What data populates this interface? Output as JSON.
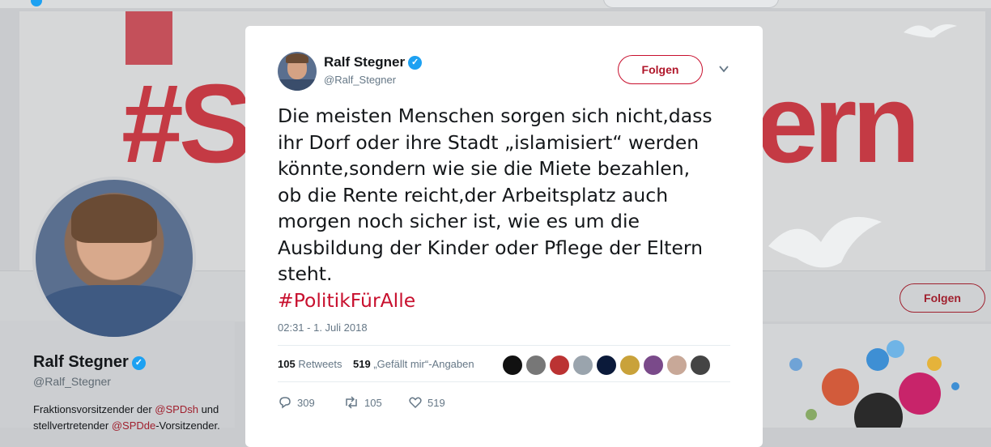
{
  "banner": {
    "hashtag_left": "#S",
    "hashtag_right": "ern"
  },
  "profile_nav": {
    "follow_label": "Folgen"
  },
  "profile": {
    "name": "Ralf Stegner",
    "handle": "@Ralf_Stegner",
    "bio_line1_prefix": "Fraktionsvorsitzender der ",
    "bio_line1_mention": "@SPDsh",
    "bio_line1_suffix": " und",
    "bio_line2_prefix": "stellvertretender ",
    "bio_line2_mention": "@SPDde",
    "bio_line2_suffix": "-Vorsitzender."
  },
  "tweet": {
    "author_name": "Ralf Stegner",
    "author_handle": "@Ralf_Stegner",
    "follow_label": "Folgen",
    "text_lines": [
      "Die meisten Menschen sorgen sich nicht,dass",
      "ihr Dorf oder ihre Stadt „islamisiert“ werden",
      "könnte,sondern wie sie die Miete bezahlen,",
      "ob die Rente reicht,der Arbeitsplatz auch",
      "morgen noch sicher ist, wie es um die",
      "Ausbildung der Kinder oder Pflege der Eltern",
      "steht."
    ],
    "hashtag": "#PolitikFürAlle",
    "timestamp": "02:31 - 1. Juli 2018",
    "retweets_count": "105",
    "retweets_label": "Retweets",
    "likes_count": "519",
    "likes_label": "„Gefällt mir“-Angaben",
    "reply_count": "309",
    "retweet_action_count": "105",
    "like_action_count": "519"
  },
  "colors": {
    "accent_red": "#c8102e",
    "verified_blue": "#1da1f2",
    "text": "#14171a",
    "muted": "#657786"
  },
  "icons": [
    "verified-badge-icon",
    "chevron-down-icon",
    "reply-icon",
    "retweet-icon",
    "like-icon"
  ]
}
